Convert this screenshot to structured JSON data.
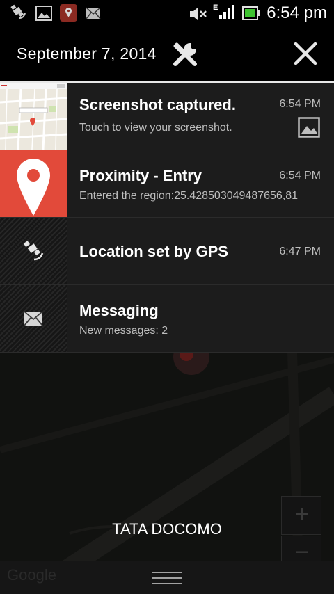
{
  "status_bar": {
    "time": "6:54 pm",
    "network": "E",
    "icons": [
      "gps-icon",
      "image-icon",
      "maps-icon",
      "message-icon",
      "mute-icon",
      "signal-icon",
      "battery-icon"
    ]
  },
  "header": {
    "date": "September 7, 2014",
    "settings_icon": "settings-icon",
    "close_icon": "close-icon"
  },
  "notifications": [
    {
      "title": "Screenshot captured.",
      "subtitle": "Touch to view your screenshot.",
      "time": "6:54 PM",
      "icon": "screenshot-thumbnail"
    },
    {
      "title": "Proximity - Entry",
      "subtitle": "Entered the region:25.428503049487656,81",
      "time": "6:54 PM",
      "icon": "map-pin-icon",
      "accent": "#e24a3a"
    },
    {
      "title": "Location set by GPS",
      "subtitle": "",
      "time": "6:47 PM",
      "icon": "gps-icon"
    },
    {
      "title": "Messaging",
      "subtitle": "New messages: 2",
      "time": "",
      "icon": "envelope-icon"
    }
  ],
  "footer": {
    "carrier": "TATA DOCOMO",
    "zoom_in": "+",
    "zoom_out": "−",
    "watermark": "Google"
  },
  "colors": {
    "background": "#000000",
    "panel": "#1c1c1c",
    "pin_red": "#e24a3a",
    "text_secondary": "#bdbdbd"
  }
}
